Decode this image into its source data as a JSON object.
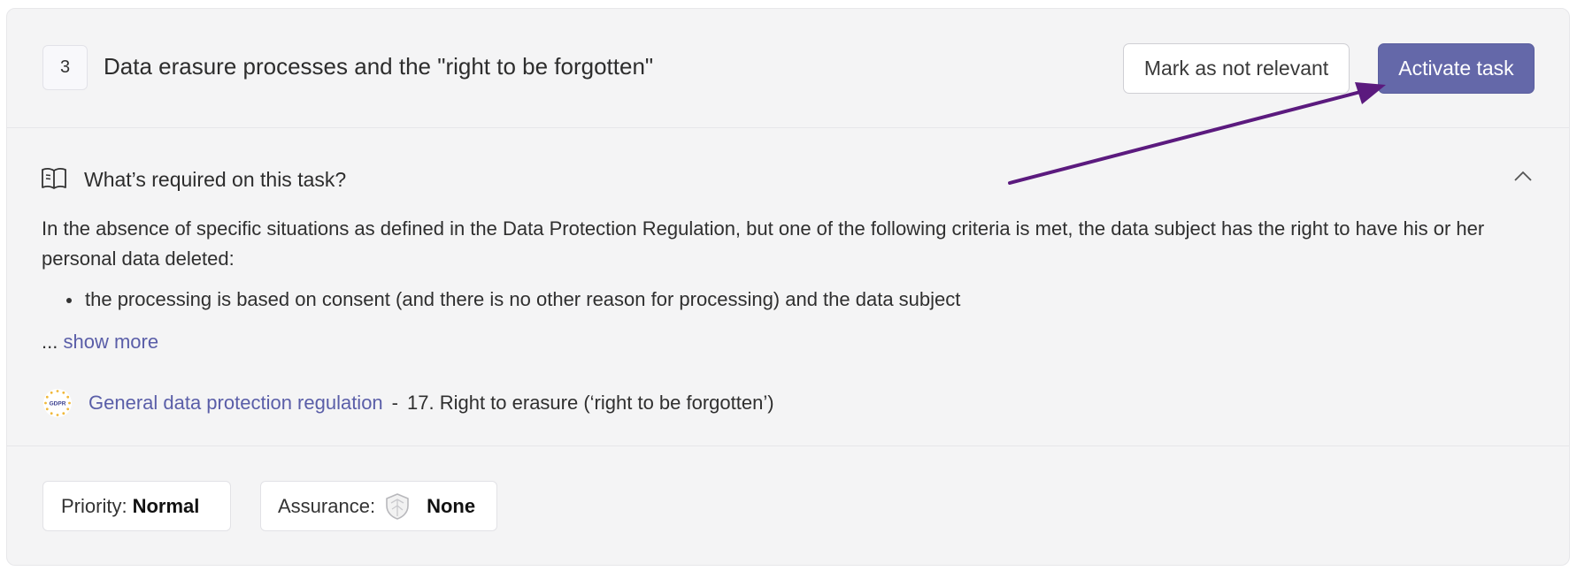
{
  "task": {
    "number": "3",
    "title": "Data erasure processes and the \"right to be forgotten\""
  },
  "actions": {
    "mark_not_relevant_label": "Mark as not relevant",
    "activate_label": "Activate task"
  },
  "requirements": {
    "heading": "What’s required on this task?",
    "description": "In the absence of specific situations as defined in the Data Protection Regulation, but one of the following criteria is met, the data subject has the right to have his or her personal data deleted:",
    "bullets": [
      "the processing is based on consent (and there is no other reason for processing) and the data subject"
    ],
    "ellipsis": "...",
    "show_more_label": "show more"
  },
  "regulation": {
    "logo_text": "GDPR",
    "link_label": "General data protection regulation",
    "separator": "-",
    "article": "17. Right to erasure (‘right to be forgotten’)"
  },
  "meta": {
    "priority_label": "Priority:",
    "priority_value": "Normal",
    "assurance_label": "Assurance:",
    "assurance_value": "None"
  },
  "colors": {
    "accent": "#6468a9",
    "link": "#5a5ea8",
    "annotation_arrow": "#5b1a7e",
    "card_background": "#f4f4f5"
  },
  "icons": {
    "requirements": "book-open-icon",
    "collapse": "chevron-up-icon",
    "regulation": "gdpr-logo",
    "assurance": "shield-icon"
  }
}
